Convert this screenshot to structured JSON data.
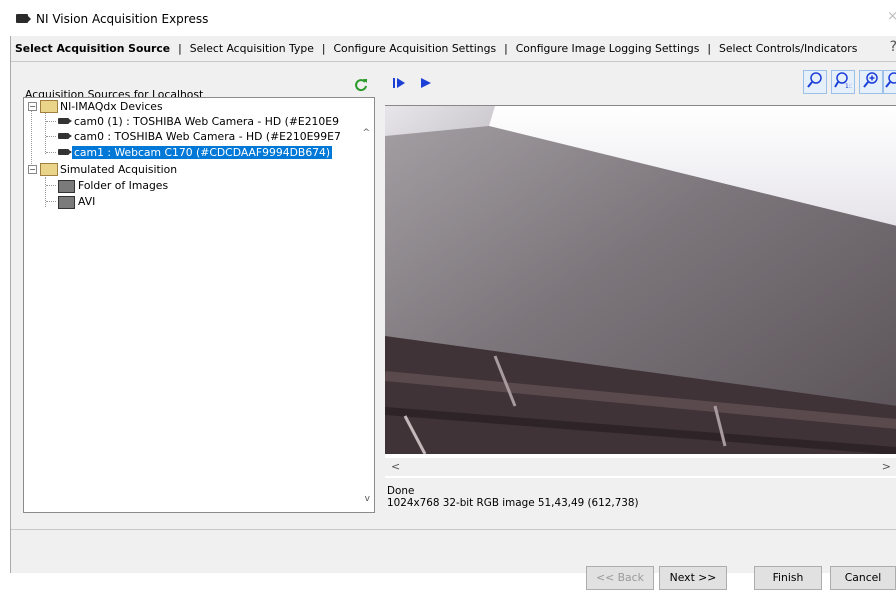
{
  "window": {
    "title": "NI Vision Acquisition Express",
    "close_glyph": "×"
  },
  "steps": [
    {
      "label": "Select Acquisition Source",
      "active": true
    },
    {
      "label": "Select Acquisition Type"
    },
    {
      "label": "Configure Acquisition Settings"
    },
    {
      "label": "Configure Image Logging Settings"
    },
    {
      "label": "Select Controls/Indicators"
    }
  ],
  "steps_separator": "|",
  "help_icon": "?",
  "sources": {
    "header": "Acquisition Sources for Localhost",
    "refresh_icon": "refresh-icon",
    "tree": [
      {
        "label": "NI-IMAQdx Devices",
        "type": "folder",
        "expanded": true
      },
      {
        "label": "cam0 (1) : TOSHIBA Web Camera - HD  (#E210E9",
        "type": "camera"
      },
      {
        "label": "cam0 : TOSHIBA Web Camera - HD  (#E210E99E7",
        "type": "camera"
      },
      {
        "label": "cam1 : Webcam C170  (#CDCDAAF9994DB674)",
        "type": "camera",
        "selected": true
      },
      {
        "label": "Simulated Acquisition",
        "type": "folder",
        "expanded": true
      },
      {
        "label": "Folder of Images",
        "type": "sim"
      },
      {
        "label": "AVI",
        "type": "sim"
      }
    ]
  },
  "viewer": {
    "toolbar": {
      "step_icon": "step-forward-icon",
      "play_icon": "play-icon"
    },
    "zoom": [
      "zoom-to-fit-icon",
      "zoom-1to1-icon",
      "zoom-in-icon",
      "zoom-out-icon"
    ],
    "scroll_left": "<",
    "scroll_right": ">"
  },
  "status": {
    "state": "Done",
    "info": "1024x768 32-bit RGB image 51,43,49    (612,738)"
  },
  "buttons": {
    "back": "<< Back",
    "next": "Next >>",
    "finish": "Finish",
    "cancel": "Cancel"
  }
}
